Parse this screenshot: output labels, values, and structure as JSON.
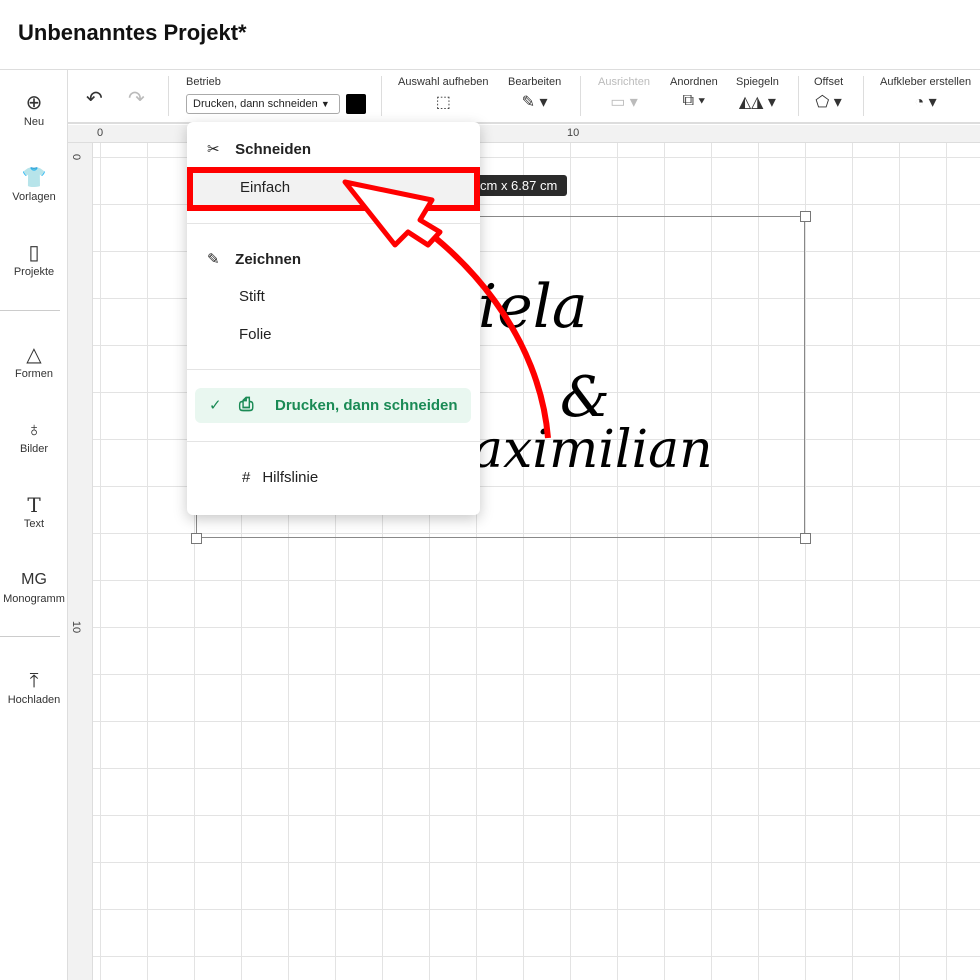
{
  "header": {
    "title": "Unbenanntes Projekt*"
  },
  "sidebar": {
    "items": [
      {
        "label": "Neu",
        "icon": "plus-circle-icon"
      },
      {
        "label": "Vorlagen",
        "icon": "shirt-icon"
      },
      {
        "label": "Projekte",
        "icon": "project-icon"
      },
      {
        "label": "Formen",
        "icon": "shapes-icon"
      },
      {
        "label": "Bilder",
        "icon": "balloon-icon"
      },
      {
        "label": "Text",
        "icon": "text-icon"
      },
      {
        "label": "Monogramm",
        "icon": "monogram-icon"
      },
      {
        "label": "Hochladen",
        "icon": "upload-icon"
      }
    ]
  },
  "toolbar": {
    "betrieb_label": "Betrieb",
    "betrieb_value": "Drucken, dann schneiden",
    "color": "#000000",
    "auswahl": "Auswahl aufheben",
    "bearbeiten": "Bearbeiten",
    "ausrichten": "Ausrichten",
    "anordnen": "Anordnen",
    "spiegeln": "Spiegeln",
    "offset": "Offset",
    "aufkleber": "Aufkleber erstellen"
  },
  "ruler": {
    "top": [
      "0",
      "10"
    ],
    "left": [
      "0",
      "10"
    ]
  },
  "canvas": {
    "dimension": "cm x 6.87  cm",
    "line1": "iela",
    "line2": "&",
    "line3": "aximilian"
  },
  "menu": {
    "schneiden": "Schneiden",
    "einfach": "Einfach",
    "zeichnen": "Zeichnen",
    "stift": "Stift",
    "folie": "Folie",
    "drucken": "Drucken, dann schneiden",
    "hilfslinie": "Hilfslinie",
    "active_color": "#1a8a55",
    "highlight_color": "#ff0000"
  }
}
